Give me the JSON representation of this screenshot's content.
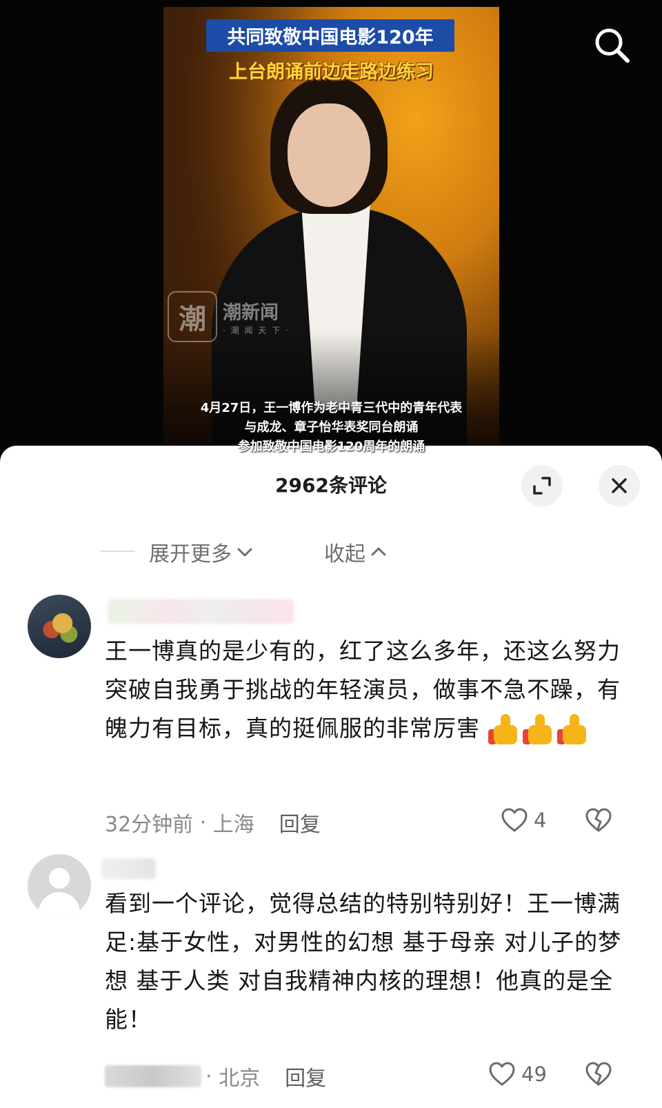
{
  "video": {
    "headline_1": "共同致敬中国电影120年",
    "headline_2": "上台朗诵前边走路边练习",
    "watermark": {
      "logo_char": "潮",
      "name": "潮新闻",
      "sub": "· 潮 闻 天 下 ·"
    },
    "caption_lines": [
      "4月27日，王一博作为老中青三代中的青年代表",
      "与成龙、章子怡华表奖同台朗诵",
      "参加致敬中国电影120周年的朗诵"
    ],
    "search_icon": "search-icon"
  },
  "comments_sheet": {
    "title": "2962条评论",
    "expand_icon": "expand-icon",
    "close_icon": "close-icon",
    "fold": {
      "more_label": "展开更多",
      "less_label": "收起"
    },
    "comments": [
      {
        "avatar": "flower-bouquet-avatar",
        "text": "王一博真的是少有的，红了这么多年，还这么努力突破自我勇于挑战的年轻演员，做事不急不躁，有魄力有目标，真的挺佩服的非常厉害",
        "emoji": [
          "👍",
          "👍",
          "👍"
        ],
        "time": "32分钟前",
        "location": "上海",
        "reply_label": "回复",
        "likes": "4"
      },
      {
        "avatar": "default-avatar",
        "text": "看到一个评论，觉得总结的特别特别好！王一博满足:基于女性，对男性的幻想 基于母亲 对儿子的梦想  基于人类  对自我精神内核的理想！他真的是全能！",
        "location": "北京",
        "reply_label": "回复",
        "likes": "49"
      }
    ]
  },
  "colors": {
    "headline_bg": "#1d4ca8",
    "headline_2": "#ffd43a",
    "sheet_bg": "#ffffff",
    "muted": "#8a8a8a"
  }
}
